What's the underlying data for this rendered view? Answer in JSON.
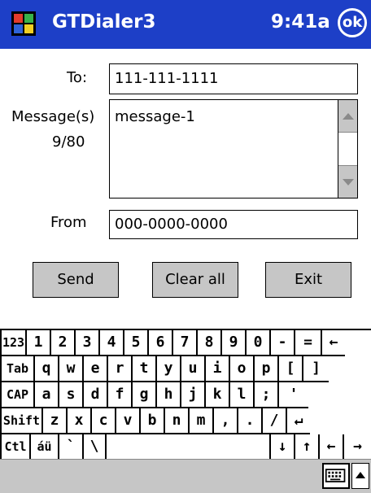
{
  "titlebar": {
    "app_title": "GTDialer3",
    "time": "9:41a",
    "ok_label": "ok",
    "bg_color": "#1d3fc7"
  },
  "form": {
    "to_label": "To:",
    "to_value": "111-111-1111",
    "message_label": "Message(s)",
    "message_count": "9/80",
    "message_value": "message-1",
    "from_label": "From",
    "from_value": "000-0000-0000"
  },
  "buttons": {
    "send": "Send",
    "clear_all": "Clear all",
    "exit": "Exit"
  },
  "keyboard": {
    "rows": [
      [
        "123",
        "1",
        "2",
        "3",
        "4",
        "5",
        "6",
        "7",
        "8",
        "9",
        "0",
        "-",
        "=",
        "←"
      ],
      [
        "Tab",
        "q",
        "w",
        "e",
        "r",
        "t",
        "y",
        "u",
        "i",
        "o",
        "p",
        "[",
        "]"
      ],
      [
        "CAP",
        "a",
        "s",
        "d",
        "f",
        "g",
        "h",
        "j",
        "k",
        "l",
        ";",
        "'"
      ],
      [
        "Shift",
        "z",
        "x",
        "c",
        "v",
        "b",
        "n",
        "m",
        ",",
        ".",
        "/",
        "↵"
      ],
      [
        "Ctl",
        "áü",
        "`",
        "\\",
        "",
        "↓",
        "↑",
        "←",
        "→"
      ]
    ]
  },
  "bottombar": {
    "keyboard_icon": "keyboard-icon",
    "arrow_icon": "triangle-up-icon"
  }
}
